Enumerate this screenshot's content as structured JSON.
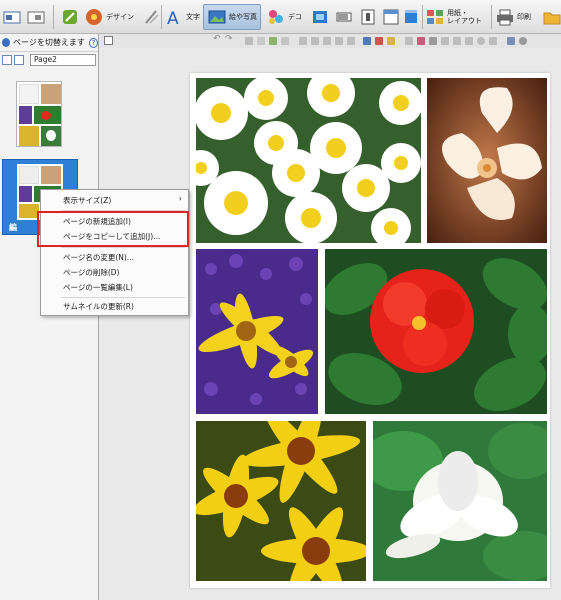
{
  "toolbar": {
    "design_label": "デザイン",
    "text_label": "文字",
    "photo_label": "絵や写真",
    "deco_label": "デコ",
    "paper_label": "用紙・\nレイアウト",
    "print_label": "印刷"
  },
  "left_panel": {
    "switch_page_label": "ページを切替えます",
    "help_glyph": "?",
    "page_name_value": "Page2",
    "selected_caption": "編"
  },
  "context_menu": {
    "items": [
      "表示サイズ(Z)",
      "ページの新規追加(I)",
      "ページをコピーして追加(J)...",
      "ページ名の変更(N)...",
      "ページの削除(D)",
      "ページの一覧編集(L)",
      "サムネイルの更新(R)"
    ],
    "submenu_arrow": "›"
  },
  "colors": {
    "selection": "#2f7fd6",
    "highlight_box": "#e0232a",
    "active_tab": "#a9c2df"
  },
  "icons": [
    "page-icon",
    "copy-icon",
    "design-icon",
    "text-icon",
    "photo-icon",
    "deco-icon",
    "print-icon",
    "folder-icon",
    "help-icon",
    "undo-icon",
    "redo-icon"
  ]
}
